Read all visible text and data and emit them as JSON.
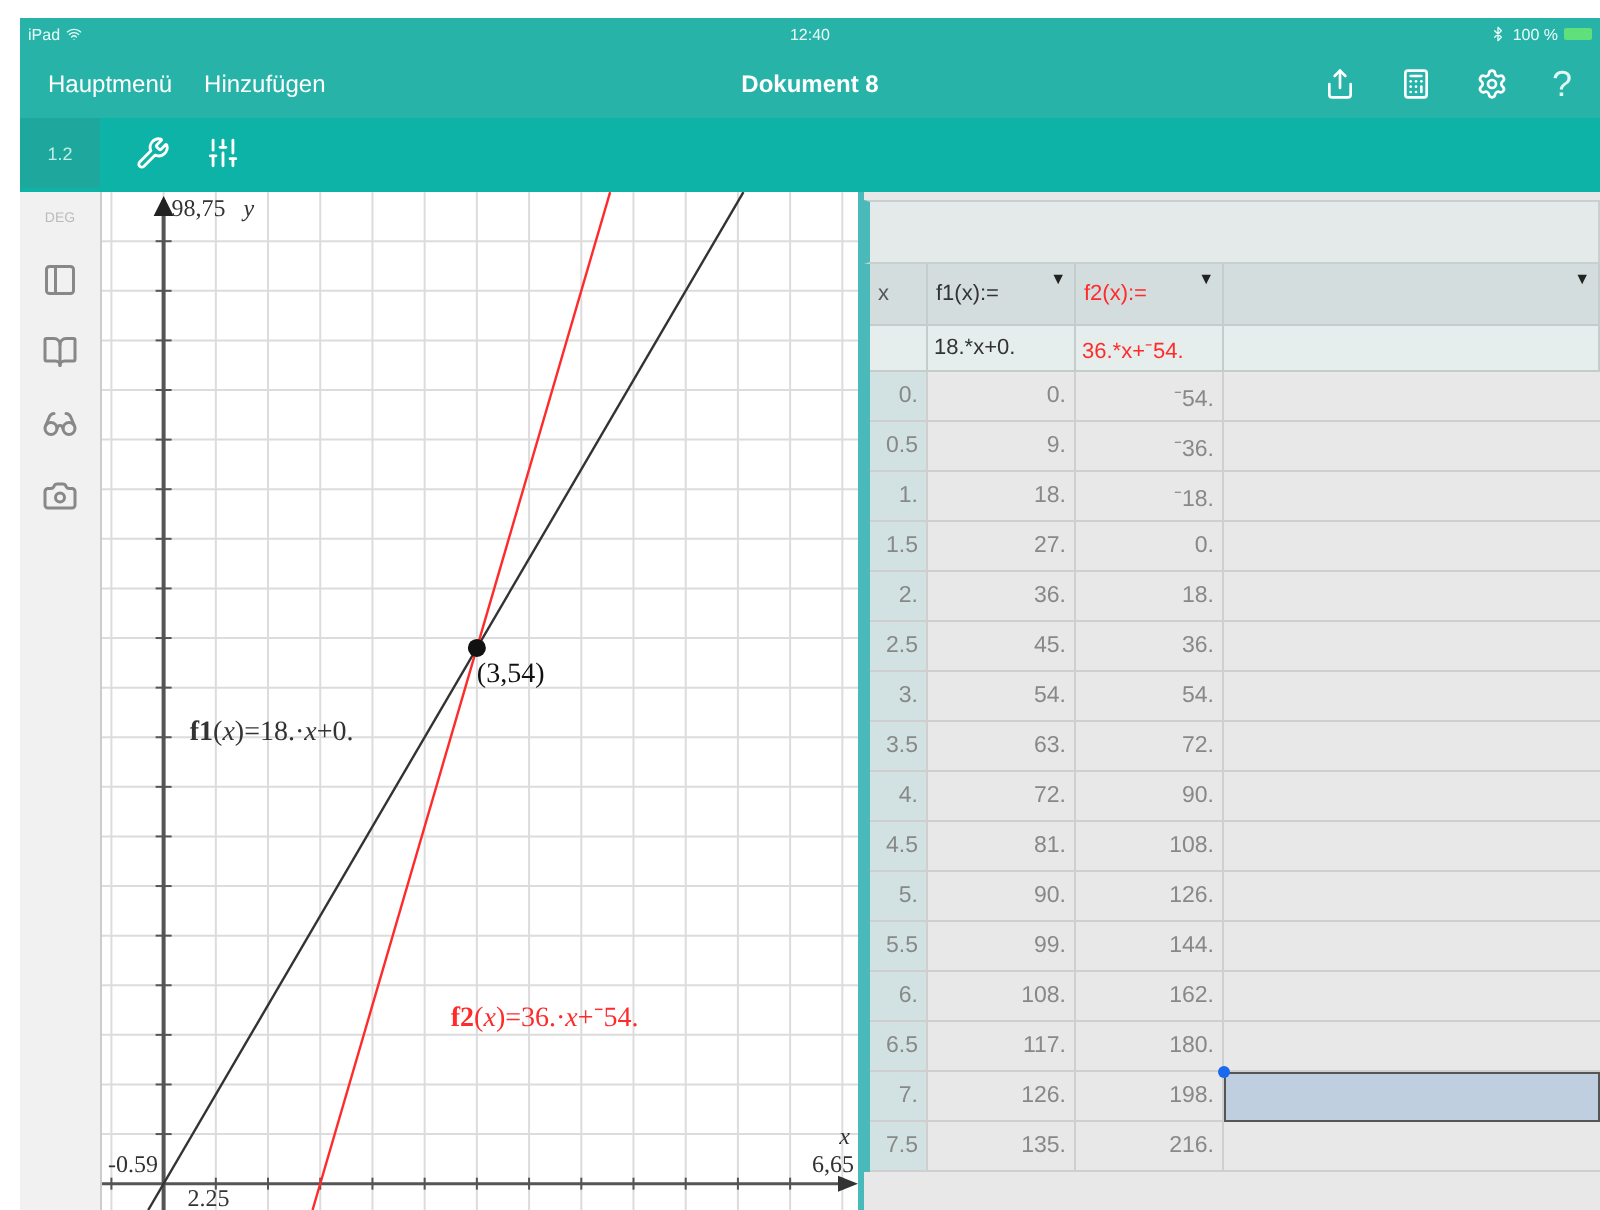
{
  "status_bar": {
    "device": "iPad",
    "time": "12:40",
    "battery": "100 %"
  },
  "nav_bar": {
    "left": [
      "Hauptmenü",
      "Hinzufügen"
    ],
    "title": "Dokument 8",
    "help": "?"
  },
  "toolbar": {
    "page": "1.2"
  },
  "sidebar": {
    "mode": "DEG"
  },
  "graph": {
    "y_max": "98,75",
    "y_label": "y",
    "x_min": "-0.59",
    "y_min": "2.25",
    "x_label": "x",
    "x_max": "6,65",
    "point_label": "(3,54)",
    "functions": [
      {
        "label": "**f1**(*x*)=18.·*x*+0.",
        "color": "#333333"
      },
      {
        "label": "**f2**(*x*)=36.·*x*+⁻54.",
        "color": "#ff2a2a"
      }
    ]
  },
  "table": {
    "columns": [
      {
        "name": "x"
      },
      {
        "name": "f1(x):=",
        "formula": "18.*x+0.",
        "color": "#333333",
        "menu": "▼"
      },
      {
        "name": "f2(x):=",
        "formula": "36.*x+⁻54.",
        "color": "#ff2a2a",
        "menu": "▼"
      },
      {
        "menu": "▼"
      }
    ],
    "rows": [
      {
        "cells": [
          "0.",
          "0.",
          "⁻54."
        ],
        "selected": false
      },
      {
        "cells": [
          "0.5",
          "9.",
          "⁻36."
        ],
        "selected": false
      },
      {
        "cells": [
          "1.",
          "18.",
          "⁻18."
        ],
        "selected": false
      },
      {
        "cells": [
          "1.5",
          "27.",
          "0."
        ],
        "selected": false
      },
      {
        "cells": [
          "2.",
          "36.",
          "18."
        ],
        "selected": false
      },
      {
        "cells": [
          "2.5",
          "45.",
          "36."
        ],
        "selected": false
      },
      {
        "cells": [
          "3.",
          "54.",
          "54."
        ],
        "selected": false
      },
      {
        "cells": [
          "3.5",
          "63.",
          "72."
        ],
        "selected": false
      },
      {
        "cells": [
          "4.",
          "72.",
          "90."
        ],
        "selected": false
      },
      {
        "cells": [
          "4.5",
          "81.",
          "108."
        ],
        "selected": false
      },
      {
        "cells": [
          "5.",
          "90.",
          "126."
        ],
        "selected": false
      },
      {
        "cells": [
          "5.5",
          "99.",
          "144."
        ],
        "selected": false
      },
      {
        "cells": [
          "6.",
          "108.",
          "162."
        ],
        "selected": false
      },
      {
        "cells": [
          "6.5",
          "117.",
          "180."
        ],
        "selected": false
      },
      {
        "cells": [
          "7.",
          "126.",
          "198."
        ],
        "selected": true
      },
      {
        "cells": [
          "7.5",
          "135.",
          "216."
        ],
        "selected": false
      }
    ]
  }
}
